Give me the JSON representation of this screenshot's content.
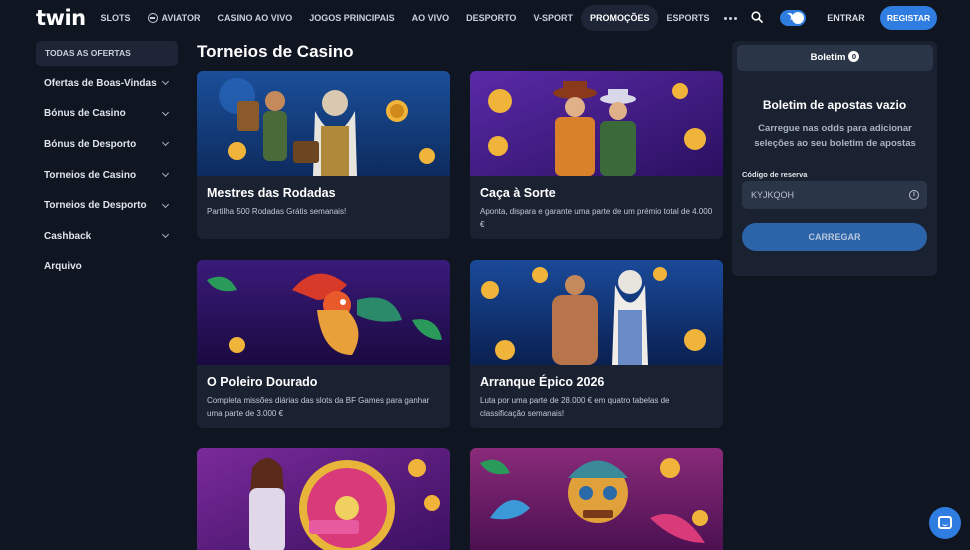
{
  "header": {
    "logo": "twin",
    "nav": [
      {
        "label": "SLOTS"
      },
      {
        "label": "AVIATOR"
      },
      {
        "label": "CASINO AO VIVO"
      },
      {
        "label": "JOGOS PRINCIPAIS"
      },
      {
        "label": "AO VIVO"
      },
      {
        "label": "DESPORTO"
      },
      {
        "label": "V-SPORT"
      },
      {
        "label": "PROMOÇÕES"
      },
      {
        "label": "ESPORTS"
      }
    ],
    "enter_label": "ENTRAR",
    "register_label": "REGISTAR"
  },
  "sidebar": {
    "all_offers": "TODAS AS OFERTAS",
    "items": [
      {
        "label": "Ofertas de Boas-Vindas"
      },
      {
        "label": "Bónus de Casino"
      },
      {
        "label": "Bónus de Desporto"
      },
      {
        "label": "Torneios de Casino"
      },
      {
        "label": "Torneios de Desporto"
      },
      {
        "label": "Cashback"
      },
      {
        "label": "Arquivo"
      }
    ]
  },
  "main": {
    "title": "Torneios de Casino",
    "cards": [
      {
        "title": "Mestres das Rodadas",
        "desc": "Partilha 500 Rodadas Grátis semanais!"
      },
      {
        "title": "Caça à Sorte",
        "desc": "Aponta, dispara e garante uma parte de um prémio total de 4.000 €"
      },
      {
        "title": "O Poleiro Dourado",
        "desc": "Completa missões diárias das slots da BF Games para ganhar uma parte de 3.000 €"
      },
      {
        "title": "Arranque Épico 2026",
        "desc": "Luta por uma parte de 28.000 € em quatro tabelas de classificação semanais!"
      },
      {
        "title": "",
        "desc": ""
      },
      {
        "title": "",
        "desc": ""
      }
    ]
  },
  "betslip": {
    "tab_label": "Boletim",
    "count": "0",
    "empty_title": "Boletim de apostas vazio",
    "hint": "Carregue nas odds para adicionar seleções ao seu boletim de apostas",
    "code_label": "Código de reserva",
    "code_value": "KYJKQOH",
    "load_label": "CARREGAR"
  },
  "colors": {
    "background": "#0f1521",
    "card": "#1a2232",
    "accent": "#2f7de1"
  }
}
